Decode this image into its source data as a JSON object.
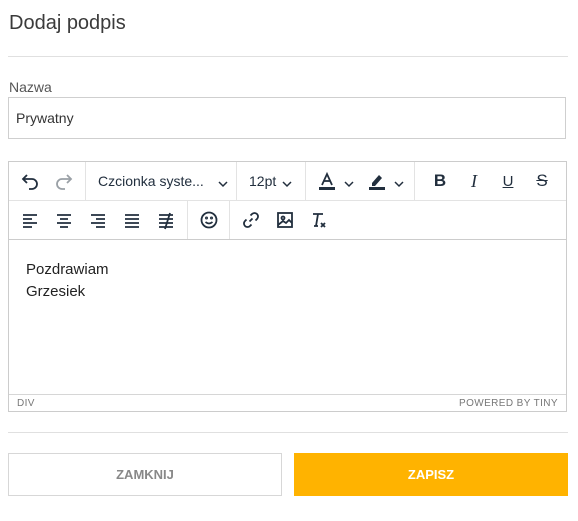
{
  "dialog": {
    "title": "Dodaj podpis"
  },
  "name_field": {
    "label": "Nazwa",
    "value": "Prywatny"
  },
  "toolbar": {
    "font_family": "Czcionka syste...",
    "font_size": "12pt"
  },
  "editor": {
    "lines": [
      "Pozdrawiam",
      "Grzesiek"
    ],
    "status_path": "DIV",
    "branding": "POWERED BY TINY"
  },
  "buttons": {
    "close": "ZAMKNIJ",
    "save": "ZAPISZ"
  },
  "colors": {
    "accent": "#ffb300",
    "toolbar_icon": "#222f3e"
  },
  "icons": [
    "undo-icon",
    "redo-icon",
    "text-color-icon",
    "highlight-icon",
    "bold-icon",
    "italic-icon",
    "underline-icon",
    "strikethrough-icon",
    "align-left-icon",
    "align-center-icon",
    "align-right-icon",
    "align-justify-icon",
    "line-height-icon",
    "emoji-icon",
    "link-icon",
    "image-icon",
    "clear-format-icon"
  ]
}
